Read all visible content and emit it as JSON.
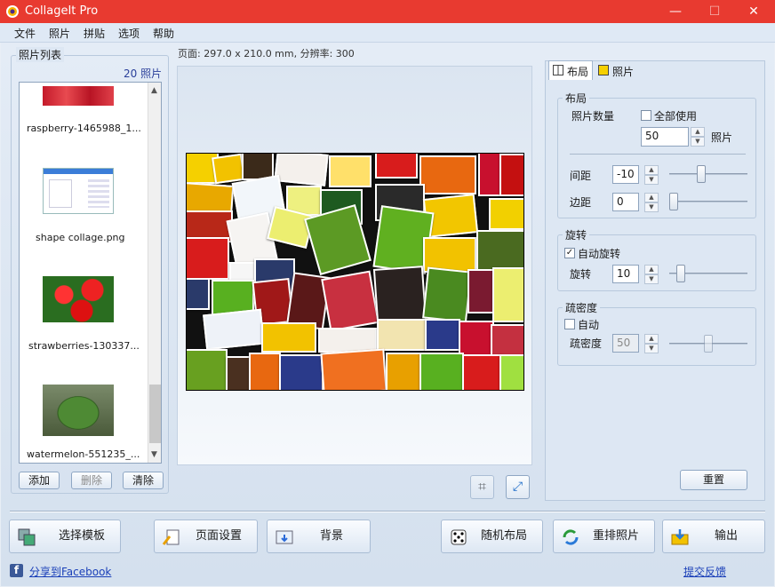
{
  "app": {
    "title": "CollageIt Pro",
    "minimize": "—",
    "maximize": "☐",
    "close": "✕"
  },
  "menu": [
    "文件",
    "照片",
    "拼贴",
    "选项",
    "帮助"
  ],
  "photo_list": {
    "title": "照片列表",
    "count": "20 照片",
    "items": [
      "raspberry-1465988_1...",
      "shape collage.png",
      "strawberries-130337...",
      "watermelon-551235_..."
    ],
    "add": "添加",
    "delete": "删除",
    "clear": "清除"
  },
  "page_info": "页面: 297.0 x 210.0 mm, 分辨率: 300",
  "tabs": {
    "layout": "布局",
    "photos": "照片"
  },
  "layout_group": {
    "title": "布局",
    "photo_count_label": "照片数量",
    "use_all_label": "全部使用",
    "photo_count_value": "50",
    "photo_unit": "照片",
    "spacing_label": "间距",
    "spacing_value": "-10",
    "margin_label": "边距",
    "margin_value": "0"
  },
  "rotation_group": {
    "title": "旋转",
    "auto_rotate_label": "自动旋转",
    "auto_rotate_checked": "✓",
    "rotate_label": "旋转",
    "rotate_value": "10"
  },
  "density_group": {
    "title": "疏密度",
    "auto_label": "自动",
    "density_label": "疏密度",
    "density_value": "50"
  },
  "reset": "重置",
  "toolbar": {
    "template": "选择模板",
    "page_setup": "页面设置",
    "background": "背景",
    "random_layout": "随机布局",
    "shuffle": "重排照片",
    "export": "输出"
  },
  "footer": {
    "share": "分享到Facebook",
    "feedback": "提交反馈"
  },
  "colors": {
    "titlebar": "#e83a30",
    "panel": "#dde7f3"
  }
}
